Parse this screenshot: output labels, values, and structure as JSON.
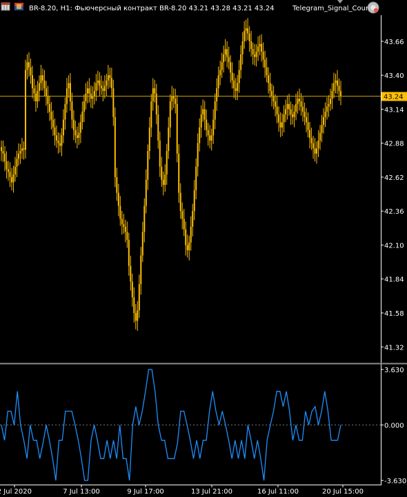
{
  "header": {
    "symbol_text": "BR-8.20, H1:  Фьючерсный контракт BR-8.20  43.21 43.28 43.21 43.24",
    "indicator_name": "Telegram_Signal_Count"
  },
  "colors": {
    "background": "#000000",
    "candles": "#FFC000",
    "price_line": "#C8A000",
    "price_tag_bg": "#FFC000",
    "indicator": "#1E90FF",
    "axis": "#FFFFFF",
    "separator": "#8C8C8C"
  },
  "icons": [
    "table-icon",
    "flag-icon",
    "expert-advisor-icon"
  ],
  "current_price_label": "43.24",
  "chart_data": [
    {
      "type": "candlestick",
      "symbol": "BR-8.20",
      "timeframe": "H1",
      "ylim": [
        41.2,
        43.86
      ],
      "y_ticks": [
        "43.66",
        "43.40",
        "43.14",
        "42.88",
        "42.62",
        "42.36",
        "42.10",
        "41.84",
        "41.58",
        "41.32"
      ],
      "x_ticks": [
        "2 Jul 2020",
        "7 Jul 13:00",
        "9 Jul 17:00",
        "13 Jul 21:00",
        "16 Jul 11:00",
        "20 Jul 15:00"
      ],
      "current_price": 43.24,
      "close": [
        42.82,
        42.8,
        42.74,
        42.68,
        42.66,
        42.62,
        42.58,
        42.64,
        42.7,
        42.76,
        42.8,
        42.82,
        42.84,
        42.83,
        43.44,
        43.5,
        43.46,
        43.4,
        43.3,
        43.26,
        43.2,
        43.28,
        43.34,
        43.4,
        43.36,
        43.3,
        43.24,
        43.18,
        43.12,
        43.06,
        43.0,
        42.94,
        42.9,
        42.88,
        42.86,
        42.94,
        43.06,
        43.18,
        43.3,
        43.34,
        43.2,
        43.06,
        42.98,
        42.94,
        42.92,
        42.96,
        43.04,
        43.12,
        43.2,
        43.26,
        43.3,
        43.26,
        43.22,
        43.24,
        43.28,
        43.34,
        43.36,
        43.32,
        43.3,
        43.28,
        43.32,
        43.36,
        43.4,
        43.38,
        43.3,
        43.08,
        42.62,
        42.5,
        42.4,
        42.3,
        42.26,
        42.24,
        42.2,
        42.14,
        41.94,
        41.82,
        41.7,
        41.58,
        41.52,
        41.6,
        41.8,
        42.02,
        42.2,
        42.4,
        42.6,
        42.82,
        43.0,
        43.2,
        43.3,
        43.26,
        43.1,
        42.9,
        42.7,
        42.6,
        42.56,
        42.64,
        42.82,
        43.0,
        43.2,
        43.24,
        43.22,
        43.18,
        42.8,
        42.5,
        42.36,
        42.3,
        42.22,
        42.1,
        42.06,
        42.12,
        42.24,
        42.36,
        42.52,
        42.7,
        42.88,
        43.0,
        43.1,
        43.14,
        43.06,
        42.98,
        42.94,
        42.9,
        42.94,
        43.06,
        43.2,
        43.3,
        43.4,
        43.44,
        43.5,
        43.56,
        43.6,
        43.54,
        43.5,
        43.42,
        43.36,
        43.3,
        43.28,
        43.34,
        43.44,
        43.56,
        43.66,
        43.74,
        43.76,
        43.72,
        43.66,
        43.6,
        43.56,
        43.54,
        43.58,
        43.62,
        43.64,
        43.58,
        43.52,
        43.46,
        43.4,
        43.34,
        43.28,
        43.24,
        43.2,
        43.16,
        43.1,
        43.04,
        43.0,
        43.04,
        43.1,
        43.14,
        43.18,
        43.14,
        43.1,
        43.08,
        43.12,
        43.18,
        43.22,
        43.2,
        43.16,
        43.12,
        43.08,
        43.04,
        42.98,
        42.92,
        42.88,
        42.84,
        42.8,
        42.84,
        42.9,
        42.96,
        43.02,
        43.08,
        43.12,
        43.16,
        43.18,
        43.22,
        43.28,
        43.34,
        43.36,
        43.32,
        43.28,
        43.24
      ]
    },
    {
      "type": "line",
      "name": "Telegram_Signal_Count",
      "ylim": [
        -3.63,
        3.63
      ],
      "y_ticks": [
        "3.630",
        "0.000",
        "-3.630"
      ],
      "zero_line": 0.0,
      "values": [
        0.0,
        -1.0,
        0.9,
        0.9,
        0.0,
        2.2,
        0.0,
        -1.0,
        -2.2,
        0.0,
        -1.0,
        -1.0,
        -2.2,
        -1.2,
        0.0,
        -1.0,
        -2.2,
        -3.63,
        -1.0,
        -1.0,
        0.9,
        0.9,
        0.9,
        0.0,
        -1.0,
        -2.2,
        -3.63,
        -3.63,
        -1.0,
        0.0,
        -1.0,
        -2.2,
        -2.2,
        -1.0,
        -2.2,
        -1.0,
        -2.2,
        0.0,
        -2.2,
        -2.2,
        -3.63,
        0.0,
        1.2,
        0.0,
        0.9,
        2.2,
        3.63,
        3.63,
        2.2,
        0.0,
        -1.0,
        -1.0,
        -2.2,
        -2.2,
        -2.2,
        -1.2,
        0.9,
        0.9,
        0.0,
        -1.0,
        -2.2,
        -1.0,
        -2.2,
        -1.0,
        -1.0,
        0.9,
        2.2,
        0.9,
        0.0,
        0.9,
        0.0,
        -1.0,
        -2.2,
        -1.0,
        -2.2,
        -1.0,
        -2.2,
        0.0,
        -1.0,
        -2.2,
        -1.0,
        -2.2,
        -3.63,
        -1.0,
        0.0,
        0.9,
        2.2,
        2.2,
        1.2,
        2.2,
        0.9,
        -1.0,
        0.0,
        -1.0,
        -1.0,
        0.9,
        0.0,
        0.9,
        1.2,
        0.0,
        0.9,
        2.2,
        0.9,
        -1.0,
        -1.0,
        -1.0,
        0.0
      ]
    }
  ]
}
